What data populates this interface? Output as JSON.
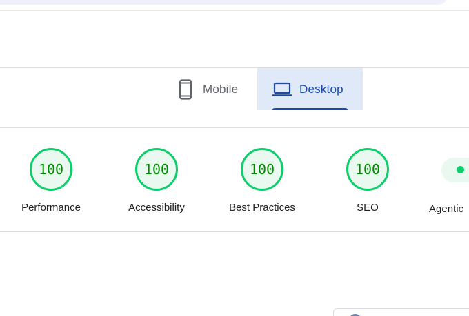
{
  "tabs": {
    "mobile": {
      "label": "Mobile",
      "icon": "smartphone-icon",
      "selected": false
    },
    "desktop": {
      "label": "Desktop",
      "icon": "laptop-icon",
      "selected": true
    }
  },
  "scores": [
    {
      "value": "100",
      "label": "Performance"
    },
    {
      "value": "100",
      "label": "Accessibility"
    },
    {
      "value": "100",
      "label": "Best Practices"
    },
    {
      "value": "100",
      "label": "SEO"
    }
  ],
  "partial_score": {
    "label": "Agentic",
    "indicator": "pass-dot"
  },
  "colors": {
    "pass": "#0cce6b",
    "pass_text": "#008800",
    "pass_fill": "#e9f9ef",
    "accent": "#1a49a8",
    "selected_tab_bg": "#e0e9f8"
  }
}
